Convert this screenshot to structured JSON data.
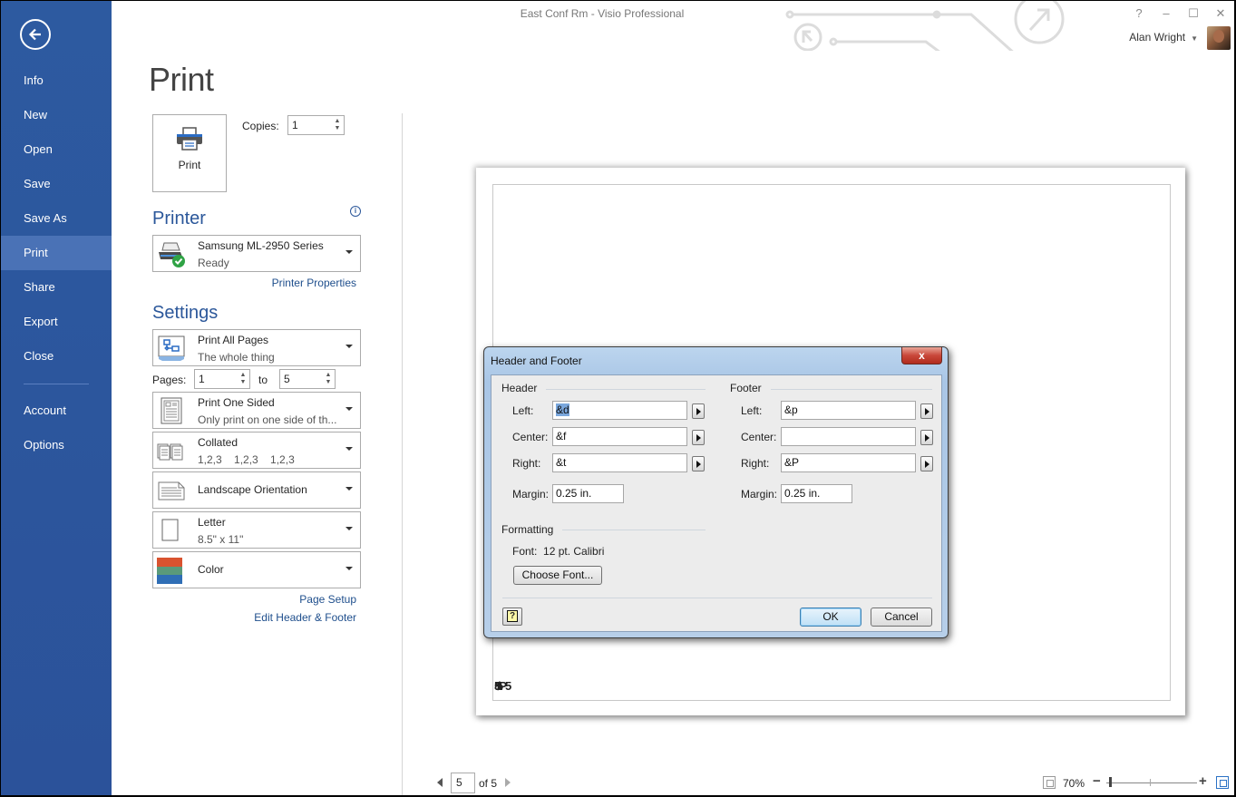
{
  "window": {
    "title": "East Conf Rm - Visio Professional",
    "controls": {
      "help": "?",
      "minimize": "–",
      "maximize": "☐",
      "close": "✕"
    },
    "user_name": "Alan Wright"
  },
  "sidebar": {
    "items": [
      {
        "label": "Info"
      },
      {
        "label": "New"
      },
      {
        "label": "Open"
      },
      {
        "label": "Save"
      },
      {
        "label": "Save As"
      },
      {
        "label": "Print",
        "active": true
      },
      {
        "label": "Share"
      },
      {
        "label": "Export"
      },
      {
        "label": "Close"
      },
      {
        "label": "Account"
      },
      {
        "label": "Options"
      }
    ]
  },
  "print": {
    "title": "Print",
    "print_button": "Print",
    "copies_label": "Copies:",
    "copies_value": "1",
    "printer_heading": "Printer",
    "printer": {
      "name": "Samsung ML-2950 Series",
      "status": "Ready"
    },
    "printer_properties_link": "Printer Properties",
    "settings_heading": "Settings",
    "settings": {
      "pages_scope": {
        "title": "Print All Pages",
        "subtitle": "The whole thing"
      },
      "pages_label": "Pages:",
      "pages_from": "1",
      "pages_to_label": "to",
      "pages_to": "5",
      "sides": {
        "title": "Print One Sided",
        "subtitle": "Only print on one side of th..."
      },
      "collation": {
        "title": "Collated",
        "subtitle": "1,2,3    1,2,3    1,2,3"
      },
      "orientation": {
        "title": "Landscape Orientation"
      },
      "paper": {
        "title": "Letter",
        "subtitle": "8.5\" x 11\""
      },
      "color": {
        "title": "Color"
      }
    },
    "page_setup_link": "Page Setup",
    "edit_header_footer_link": "Edit Header & Footer"
  },
  "preview": {
    "footer_overlap_texts": [
      "5/5",
      "&P",
      "5"
    ],
    "current_page": "5",
    "of_pages": "of 5",
    "zoom_level": "70%",
    "zoom_percent": 70
  },
  "dialog": {
    "title": "Header and Footer",
    "close": "x",
    "header": {
      "heading": "Header",
      "left_label": "Left:",
      "left_value": "&d",
      "center_label": "Center:",
      "center_value": "&f",
      "right_label": "Right:",
      "right_value": "&t",
      "margin_label": "Margin:",
      "margin_value": "0.25 in."
    },
    "footer": {
      "heading": "Footer",
      "left_label": "Left:",
      "left_value": "&p",
      "center_label": "Center:",
      "center_value": "",
      "right_label": "Right:",
      "right_value": "&P",
      "margin_label": "Margin:",
      "margin_value": "0.25 in."
    },
    "formatting": {
      "heading": "Formatting",
      "font_label": "Font:  12 pt. Calibri",
      "choose_font": "Choose Font..."
    },
    "help": "?",
    "ok": "OK",
    "cancel": "Cancel"
  }
}
